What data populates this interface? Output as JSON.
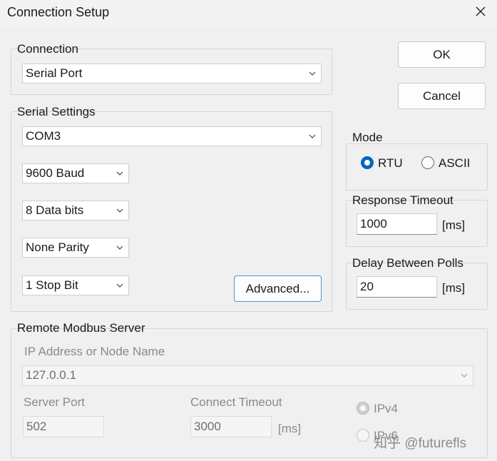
{
  "window": {
    "title": "Connection Setup"
  },
  "connection": {
    "label": "Connection",
    "type": "Serial Port"
  },
  "serial": {
    "label": "Serial Settings",
    "port": "COM3",
    "baud": "9600 Baud",
    "data_bits": "8 Data bits",
    "parity": "None Parity",
    "stop_bits": "1 Stop Bit",
    "advanced_label": "Advanced..."
  },
  "buttons": {
    "ok": "OK",
    "cancel": "Cancel"
  },
  "mode": {
    "label": "Mode",
    "rtu": "RTU",
    "ascii": "ASCII",
    "selected": "RTU"
  },
  "response_timeout": {
    "label": "Response Timeout",
    "value": "1000",
    "unit": "[ms]"
  },
  "delay_between_polls": {
    "label": "Delay Between Polls",
    "value": "20",
    "unit": "[ms]"
  },
  "remote": {
    "label": "Remote Modbus Server",
    "ip_label": "IP Address or Node Name",
    "ip_value": "127.0.0.1",
    "port_label": "Server Port",
    "port_value": "502",
    "timeout_label": "Connect Timeout",
    "timeout_value": "3000",
    "timeout_unit": "[ms]",
    "ipv4": "IPv4",
    "ipv6": "IPv6"
  },
  "watermark": "知乎 @futurefls",
  "colors": {
    "accent": "#0067c0",
    "background": "#f0f0f0",
    "disabled_text": "#8a8a8a"
  }
}
